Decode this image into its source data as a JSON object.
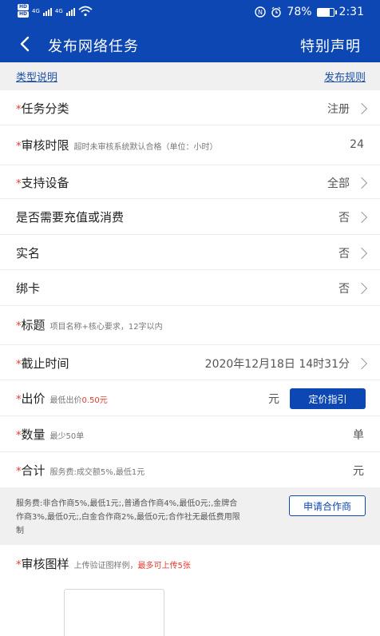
{
  "status_bar": {
    "time": "2:31",
    "battery": "78%",
    "battery_level": 0.78,
    "sim1": "HD",
    "sim2": "HD",
    "net1": "4G",
    "net2": "4G"
  },
  "header": {
    "title": "发布网络任务",
    "right_action": "特别声明"
  },
  "links": {
    "type_desc": "类型说明",
    "publish_rules": "发布规则"
  },
  "form": {
    "required_mark": "*",
    "category": {
      "label": "任务分类",
      "value": "注册"
    },
    "review_time": {
      "label": "审核时限",
      "hint": "超时未审核系统默认合格（单位：小时）",
      "value": "24"
    },
    "device": {
      "label": "支持设备",
      "value": "全部"
    },
    "recharge": {
      "label": "是否需要充值或消费",
      "value": "否"
    },
    "realname": {
      "label": "实名",
      "value": "否"
    },
    "bindcard": {
      "label": "绑卡",
      "value": "否"
    },
    "title": {
      "label": "标题",
      "hint": "项目名称+核心要求，12字以内"
    },
    "deadline": {
      "label": "截止时间",
      "value": "2020年12月18日 14时31分"
    },
    "price": {
      "label": "出价",
      "hint": "最低出价",
      "hint_value": "0.50元",
      "unit": "元",
      "button": "定价指引"
    },
    "quantity": {
      "label": "数量",
      "hint": "最少50单",
      "unit": "单"
    },
    "total": {
      "label": "合计",
      "hint": "服务费:成交额5%,最低1元",
      "unit": "元"
    }
  },
  "fee_info": {
    "text": "服务费:非合作商5%,最低1元;,普通合作商4%,最低0元;,金牌合作商3%,最低0元;,白金合作商2%,最低0元;合作社无最低费用限制",
    "button": "申请合作商"
  },
  "review_sample": {
    "label": "审核图样",
    "hint": "上传验证图样例，",
    "hint_red": "最多可上传5张"
  }
}
